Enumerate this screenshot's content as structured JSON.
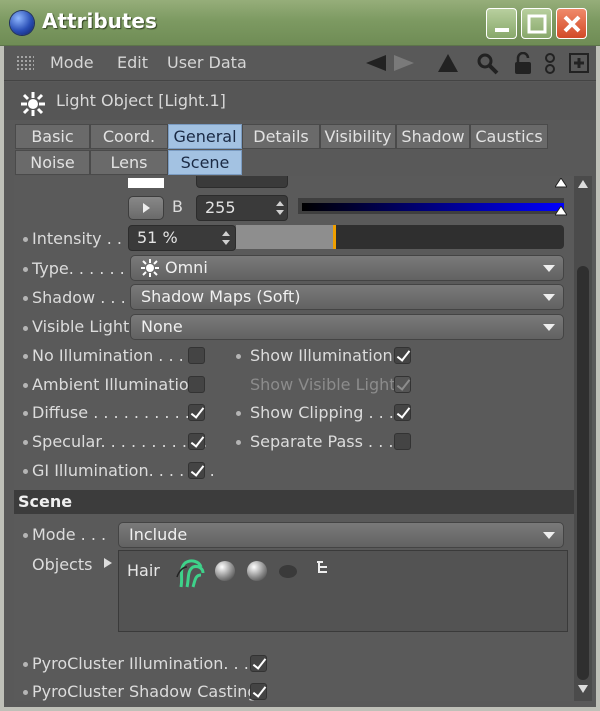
{
  "window": {
    "title": "Attributes"
  },
  "menu": {
    "items": [
      "Mode",
      "Edit",
      "User Data"
    ]
  },
  "object": {
    "name": "Light Object [Light.1]"
  },
  "tabs": {
    "row1": [
      "Basic",
      "Coord.",
      "General",
      "Details",
      "Visibility",
      "Shadow",
      "Caustics"
    ],
    "row2": [
      "Noise",
      "Lens",
      "Scene"
    ],
    "active": [
      "General",
      "Scene"
    ]
  },
  "color": {
    "b_label": "B",
    "b_value": "255",
    "blue_gradient_end": "#0000ff"
  },
  "general": {
    "intensity_label": "Intensity . . .",
    "intensity_value": "51 %",
    "intensity_fraction": 0.51,
    "type_label": "Type. . . . . .",
    "type_value": "Omni",
    "shadow_label": "Shadow . . .",
    "shadow_value": "Shadow Maps (Soft)",
    "visible_light_label": "Visible Light",
    "visible_light_value": "None",
    "checks_left": [
      {
        "label": "No Illumination . . . .",
        "checked": false
      },
      {
        "label": "Ambient Illumination",
        "checked": false
      },
      {
        "label": "Diffuse . . . . . . . . . . .",
        "checked": true
      },
      {
        "label": "Specular. . . . . . . . . . .",
        "checked": true
      },
      {
        "label": "GI Illumination. . . . . . .",
        "checked": true
      }
    ],
    "checks_right": [
      {
        "label": "Show Illumination",
        "checked": true,
        "disabled": false
      },
      {
        "label": "Show Visible Light",
        "checked": true,
        "disabled": true
      },
      {
        "label": "Show Clipping . . .",
        "checked": true,
        "disabled": false
      },
      {
        "label": "Separate Pass . . . .",
        "checked": false,
        "disabled": false
      }
    ]
  },
  "scene": {
    "section_title": "Scene",
    "mode_label": "Mode . . .",
    "mode_value": "Include",
    "objects_label": "Objects",
    "objects_item": "Hair",
    "pyro_illum_label": "PyroCluster Illumination. . . .",
    "pyro_illum_checked": true,
    "pyro_shadow_label": "PyroCluster Shadow Casting",
    "pyro_shadow_checked": true
  },
  "colors": {
    "accent_tab": "#a3c2e2",
    "slider_marker": "#f0a000",
    "titlebar": "#7d9a62",
    "close_button": "#d24a27"
  }
}
